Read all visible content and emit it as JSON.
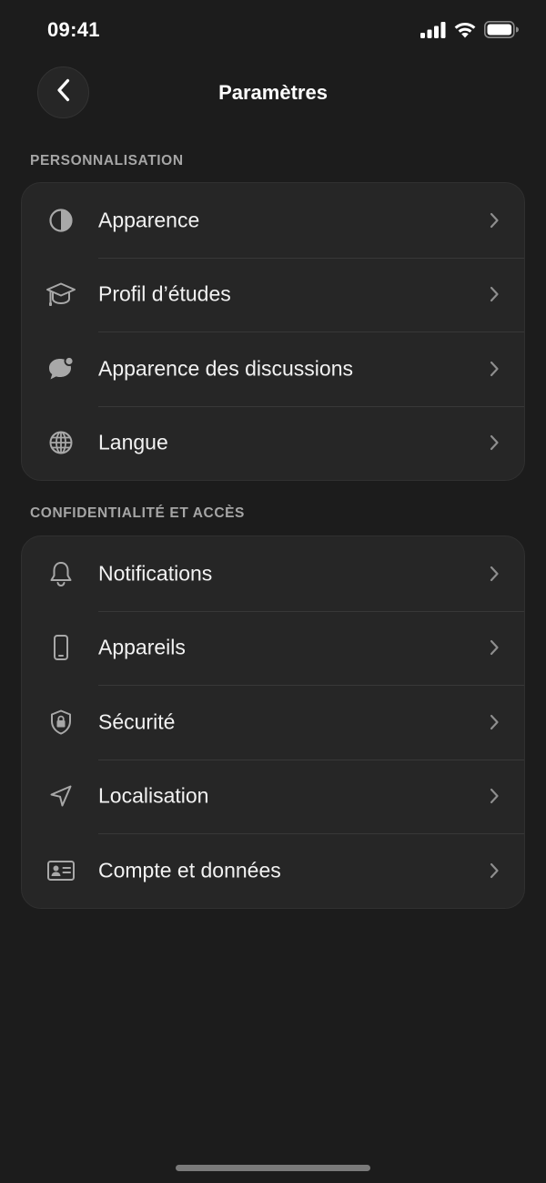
{
  "status_bar": {
    "time": "09:41",
    "icons": [
      "cellular-signal-icon",
      "wifi-icon",
      "battery-icon"
    ]
  },
  "header": {
    "title": "Paramètres",
    "back_icon": "chevron-left-icon"
  },
  "sections": [
    {
      "title": "PERSONNALISATION",
      "items": [
        {
          "label": "Apparence",
          "icon": "contrast-icon"
        },
        {
          "label": "Profil d’études",
          "icon": "graduation-cap-icon"
        },
        {
          "label": "Apparence des discussions",
          "icon": "chat-bubble-icon"
        },
        {
          "label": "Langue",
          "icon": "globe-icon"
        }
      ]
    },
    {
      "title": "CONFIDENTIALITÉ ET ACCÈS",
      "items": [
        {
          "label": "Notifications",
          "icon": "bell-icon"
        },
        {
          "label": "Appareils",
          "icon": "phone-icon"
        },
        {
          "label": "Sécurité",
          "icon": "shield-lock-icon"
        },
        {
          "label": "Localisation",
          "icon": "location-arrow-icon"
        },
        {
          "label": "Compte et données",
          "icon": "id-card-icon"
        }
      ]
    }
  ],
  "colors": {
    "background": "#1c1c1c",
    "card": "#262626",
    "text": "#f2f2f2",
    "section_header": "#a6a6a6",
    "icon": "#a8a8a8",
    "chevron": "#8e8e8e"
  }
}
